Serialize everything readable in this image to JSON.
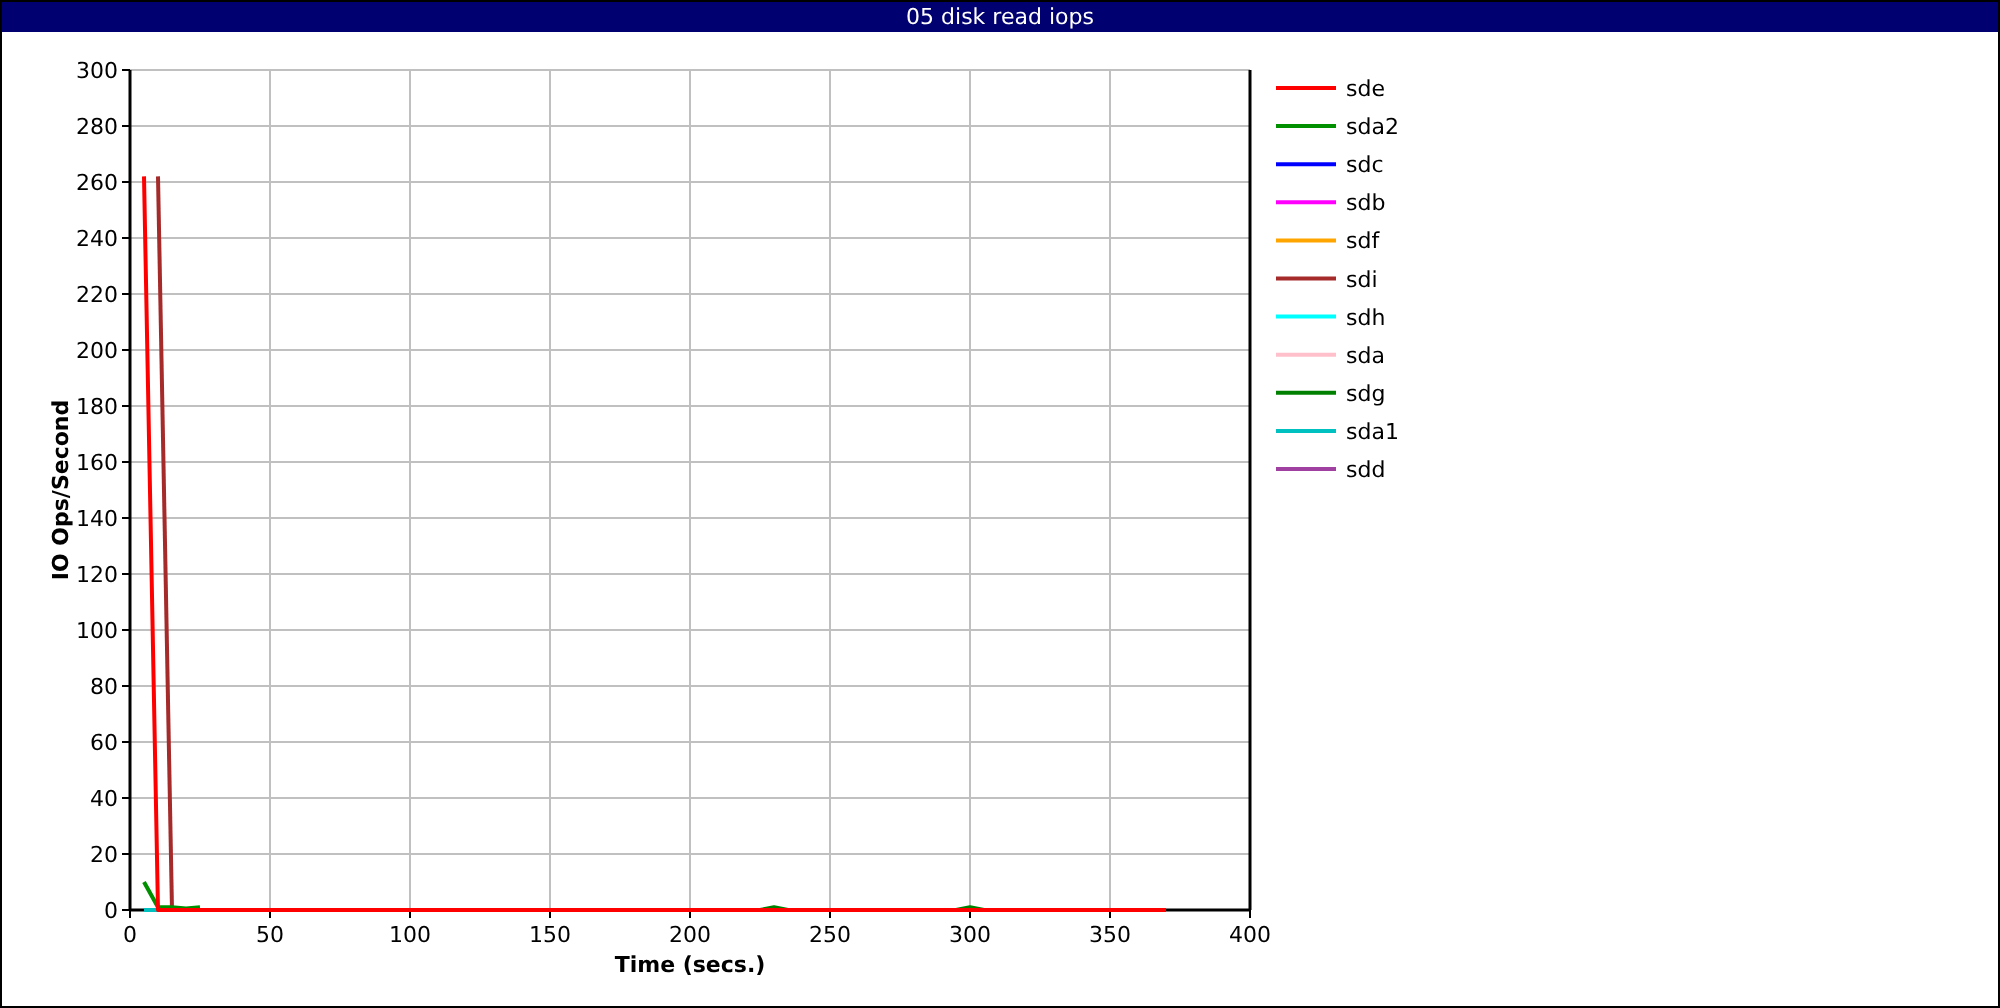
{
  "window": {
    "title": "05 disk read iops"
  },
  "chart": {
    "chart_data": {
      "type": "line",
      "xlabel": "Time (secs.)",
      "ylabel": "IO Ops/Second",
      "xlim": [
        0,
        400
      ],
      "ylim": [
        0,
        300
      ],
      "grid": true,
      "legend": true,
      "xticks": [
        0,
        50,
        100,
        150,
        200,
        250,
        300,
        350,
        400
      ],
      "yticks": [
        0,
        20,
        40,
        60,
        80,
        100,
        120,
        140,
        160,
        180,
        200,
        220,
        240,
        260,
        280,
        300
      ],
      "x": [
        5,
        10,
        15,
        20,
        25,
        30,
        35,
        40,
        45,
        50,
        55,
        60,
        65,
        70,
        75,
        80,
        85,
        90,
        95,
        100,
        105,
        110,
        115,
        120,
        125,
        130,
        135,
        140,
        145,
        150,
        155,
        160,
        165,
        170,
        175,
        180,
        185,
        190,
        195,
        200,
        205,
        210,
        215,
        220,
        225,
        230,
        235,
        240,
        245,
        250,
        255,
        260,
        265,
        270,
        275,
        280,
        285,
        290,
        295,
        300,
        305,
        310,
        315,
        320,
        325,
        330,
        335,
        340,
        345,
        350,
        355,
        360,
        365,
        370
      ],
      "series": [
        {
          "name": "sde",
          "color": "#ff0000",
          "values": [
            262,
            0,
            0,
            0,
            0,
            0,
            0,
            0,
            0,
            0,
            0,
            0,
            0,
            0,
            0,
            0,
            0,
            0,
            0,
            0,
            0,
            0,
            0,
            0,
            0,
            0,
            0,
            0,
            0,
            0,
            0,
            0,
            0,
            0,
            0,
            0,
            0,
            0,
            0,
            0,
            0,
            0,
            0,
            0,
            0,
            0,
            0,
            0,
            0,
            0,
            0,
            0,
            0,
            0,
            0,
            0,
            0,
            0,
            0,
            0,
            0,
            0,
            0,
            0,
            0,
            0,
            0,
            0,
            0,
            0,
            0,
            0,
            0,
            0
          ]
        },
        {
          "name": "sda2",
          "color": "#009000",
          "values": [
            10,
            1,
            1,
            0.5,
            1,
            null,
            null,
            null,
            null,
            null,
            null,
            null,
            null,
            null,
            null,
            null,
            null,
            null,
            null,
            null,
            null,
            null,
            null,
            null,
            null,
            null,
            null,
            null,
            null,
            null,
            null,
            null,
            null,
            null,
            null,
            null,
            null,
            null,
            null,
            null,
            null,
            null,
            null,
            null,
            null,
            null,
            null,
            null,
            null,
            null,
            null,
            null,
            null,
            null,
            null,
            null,
            null,
            null,
            null,
            null,
            null,
            null,
            null,
            null,
            null,
            null,
            null,
            null,
            null,
            null,
            null,
            null,
            null,
            null
          ]
        },
        {
          "name": "sdc",
          "color": "#0000ff",
          "values": [
            null,
            null,
            null,
            null,
            null,
            null,
            null,
            null,
            null,
            null,
            null,
            null,
            null,
            null,
            null,
            null,
            null,
            null,
            null,
            null,
            null,
            null,
            null,
            null,
            null,
            null,
            null,
            null,
            null,
            null,
            null,
            null,
            null,
            null,
            null,
            null,
            null,
            null,
            null,
            null,
            null,
            null,
            null,
            null,
            null,
            null,
            null,
            null,
            null,
            null,
            null,
            null,
            null,
            null,
            null,
            null,
            null,
            null,
            null,
            null,
            null,
            null,
            null,
            null,
            null,
            null,
            null,
            null,
            null,
            null,
            null,
            null,
            null,
            null
          ]
        },
        {
          "name": "sdb",
          "color": "#ff00ff",
          "values": [
            null,
            null,
            null,
            null,
            null,
            null,
            null,
            null,
            null,
            null,
            null,
            null,
            null,
            null,
            null,
            null,
            null,
            null,
            null,
            null,
            null,
            null,
            null,
            null,
            null,
            null,
            null,
            null,
            null,
            null,
            null,
            null,
            null,
            null,
            null,
            null,
            null,
            null,
            null,
            null,
            null,
            null,
            null,
            null,
            null,
            null,
            null,
            null,
            null,
            null,
            null,
            null,
            null,
            null,
            null,
            null,
            null,
            null,
            null,
            null,
            null,
            null,
            null,
            null,
            null,
            null,
            null,
            null,
            null,
            null,
            null,
            null,
            null,
            null
          ]
        },
        {
          "name": "sdf",
          "color": "#ffa500",
          "values": [
            null,
            null,
            null,
            null,
            null,
            null,
            null,
            null,
            null,
            null,
            null,
            null,
            null,
            null,
            null,
            null,
            null,
            null,
            null,
            null,
            null,
            null,
            null,
            null,
            null,
            null,
            null,
            null,
            null,
            null,
            null,
            null,
            null,
            null,
            null,
            null,
            null,
            null,
            null,
            null,
            null,
            null,
            null,
            null,
            null,
            null,
            null,
            null,
            null,
            null,
            null,
            null,
            null,
            null,
            null,
            null,
            null,
            null,
            null,
            null,
            null,
            null,
            null,
            null,
            null,
            null,
            null,
            null,
            null,
            null,
            null,
            null,
            null,
            null
          ]
        },
        {
          "name": "sdi",
          "color": "#a52a2a",
          "values": [
            null,
            262,
            0,
            null,
            null,
            null,
            null,
            null,
            null,
            null,
            null,
            null,
            null,
            null,
            null,
            null,
            null,
            null,
            null,
            null,
            null,
            null,
            null,
            null,
            null,
            null,
            null,
            null,
            null,
            null,
            null,
            null,
            null,
            null,
            null,
            null,
            null,
            null,
            null,
            null,
            null,
            null,
            null,
            null,
            null,
            null,
            null,
            null,
            null,
            null,
            null,
            null,
            null,
            null,
            null,
            null,
            null,
            null,
            null,
            null,
            null,
            null,
            null,
            null,
            null,
            null,
            null,
            null,
            null,
            null,
            null,
            null,
            null,
            null
          ]
        },
        {
          "name": "sdh",
          "color": "#00ffff",
          "values": [
            null,
            null,
            null,
            null,
            null,
            null,
            null,
            null,
            null,
            null,
            null,
            null,
            null,
            null,
            null,
            null,
            null,
            null,
            null,
            null,
            null,
            null,
            null,
            null,
            null,
            null,
            null,
            null,
            null,
            null,
            null,
            null,
            null,
            null,
            null,
            null,
            null,
            null,
            null,
            null,
            null,
            null,
            null,
            null,
            null,
            null,
            null,
            null,
            null,
            null,
            null,
            null,
            null,
            null,
            null,
            null,
            null,
            null,
            null,
            null,
            null,
            null,
            null,
            null,
            null,
            null,
            null,
            null,
            null,
            null,
            null,
            null,
            null,
            null
          ]
        },
        {
          "name": "sda",
          "color": "#ffc0cb",
          "values": [
            null,
            null,
            null,
            null,
            null,
            null,
            null,
            null,
            null,
            null,
            null,
            null,
            null,
            null,
            null,
            null,
            null,
            null,
            null,
            null,
            null,
            null,
            null,
            null,
            null,
            null,
            null,
            null,
            null,
            null,
            null,
            null,
            null,
            null,
            null,
            null,
            null,
            null,
            null,
            null,
            null,
            null,
            null,
            null,
            null,
            null,
            null,
            null,
            null,
            null,
            null,
            null,
            null,
            null,
            null,
            null,
            null,
            null,
            null,
            null,
            null,
            null,
            null,
            null,
            null,
            null,
            null,
            null,
            null,
            null,
            null,
            null,
            null,
            null
          ]
        },
        {
          "name": "sdg",
          "color": "#008000",
          "values": [
            null,
            null,
            null,
            null,
            null,
            null,
            null,
            null,
            null,
            null,
            null,
            null,
            null,
            null,
            null,
            null,
            null,
            null,
            null,
            null,
            null,
            null,
            null,
            null,
            null,
            null,
            null,
            null,
            null,
            null,
            null,
            null,
            null,
            null,
            null,
            null,
            null,
            null,
            null,
            null,
            null,
            null,
            null,
            null,
            0,
            1,
            0,
            null,
            null,
            null,
            null,
            null,
            null,
            null,
            null,
            null,
            null,
            null,
            0,
            1,
            0,
            null,
            null,
            null,
            null,
            null,
            null,
            null,
            null,
            null,
            null,
            null,
            null,
            null
          ]
        },
        {
          "name": "sda1",
          "color": "#00c0c0",
          "values": [
            0,
            0,
            null,
            null,
            null,
            null,
            null,
            null,
            null,
            null,
            null,
            null,
            null,
            null,
            null,
            null,
            null,
            null,
            null,
            null,
            null,
            null,
            null,
            null,
            null,
            null,
            null,
            null,
            null,
            null,
            null,
            null,
            null,
            null,
            null,
            null,
            null,
            null,
            null,
            null,
            null,
            null,
            null,
            null,
            null,
            null,
            null,
            null,
            null,
            null,
            null,
            null,
            null,
            null,
            null,
            null,
            null,
            null,
            null,
            null,
            null,
            null,
            null,
            null,
            null,
            null,
            null,
            null,
            null,
            null,
            null,
            null,
            null,
            null
          ]
        },
        {
          "name": "sdd",
          "color": "#a040a0",
          "values": [
            null,
            null,
            null,
            null,
            null,
            null,
            null,
            null,
            null,
            null,
            null,
            null,
            null,
            null,
            null,
            null,
            null,
            null,
            null,
            null,
            null,
            null,
            null,
            null,
            null,
            null,
            null,
            null,
            null,
            null,
            null,
            null,
            null,
            null,
            null,
            null,
            null,
            null,
            null,
            null,
            null,
            null,
            null,
            null,
            null,
            null,
            null,
            null,
            null,
            null,
            null,
            null,
            null,
            null,
            null,
            null,
            null,
            null,
            null,
            null,
            null,
            null,
            null,
            null,
            null,
            null,
            null,
            null,
            null,
            null,
            null,
            null,
            null,
            null
          ]
        }
      ]
    }
  }
}
